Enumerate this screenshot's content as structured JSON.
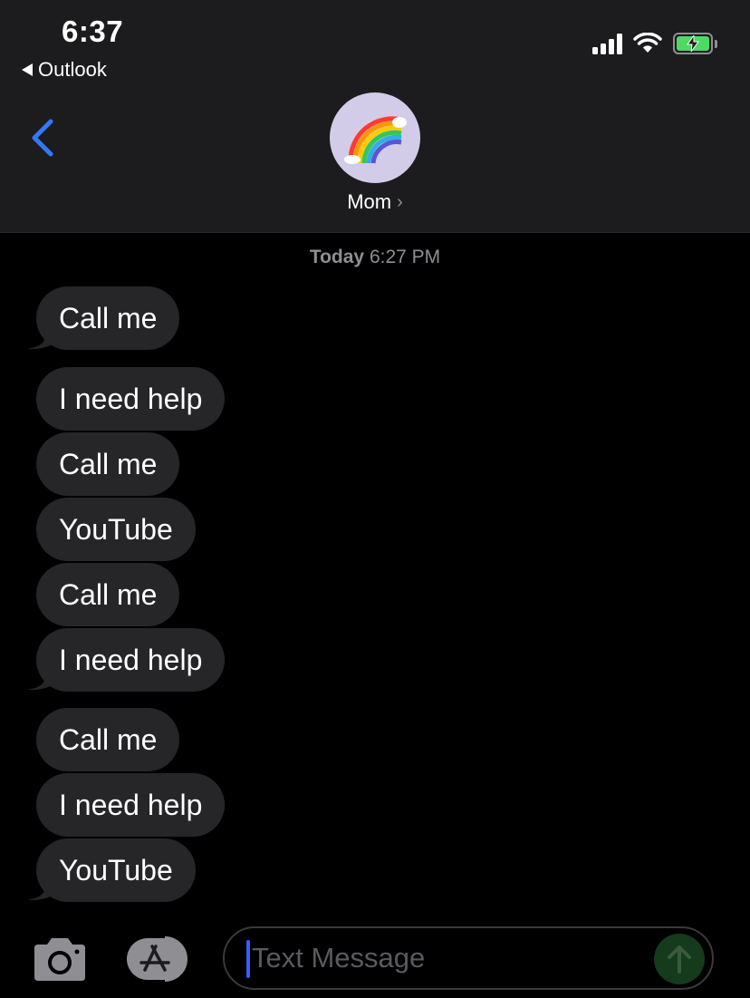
{
  "status_bar": {
    "time": "6:37",
    "back_app_label": "Outlook"
  },
  "header": {
    "contact_name": "Mom",
    "avatar_emoji": "🌈",
    "avatar_bg": "#d3cce9",
    "accent_color": "#3478f6"
  },
  "thread": {
    "timestamp_day": "Today",
    "timestamp_time": "6:27 PM",
    "messages": [
      {
        "text": "Call me"
      },
      {
        "text": "I need help"
      },
      {
        "text": "Call me"
      },
      {
        "text": "YouTube"
      },
      {
        "text": "Call me"
      },
      {
        "text": "I need help"
      },
      {
        "text": "Call me"
      },
      {
        "text": "I need help"
      },
      {
        "text": "YouTube"
      }
    ]
  },
  "composer": {
    "placeholder": "Text Message"
  },
  "icons": {
    "back": "chevron-left-icon",
    "camera": "camera-icon",
    "apps": "app-store-icon",
    "send": "arrow-up-icon"
  }
}
